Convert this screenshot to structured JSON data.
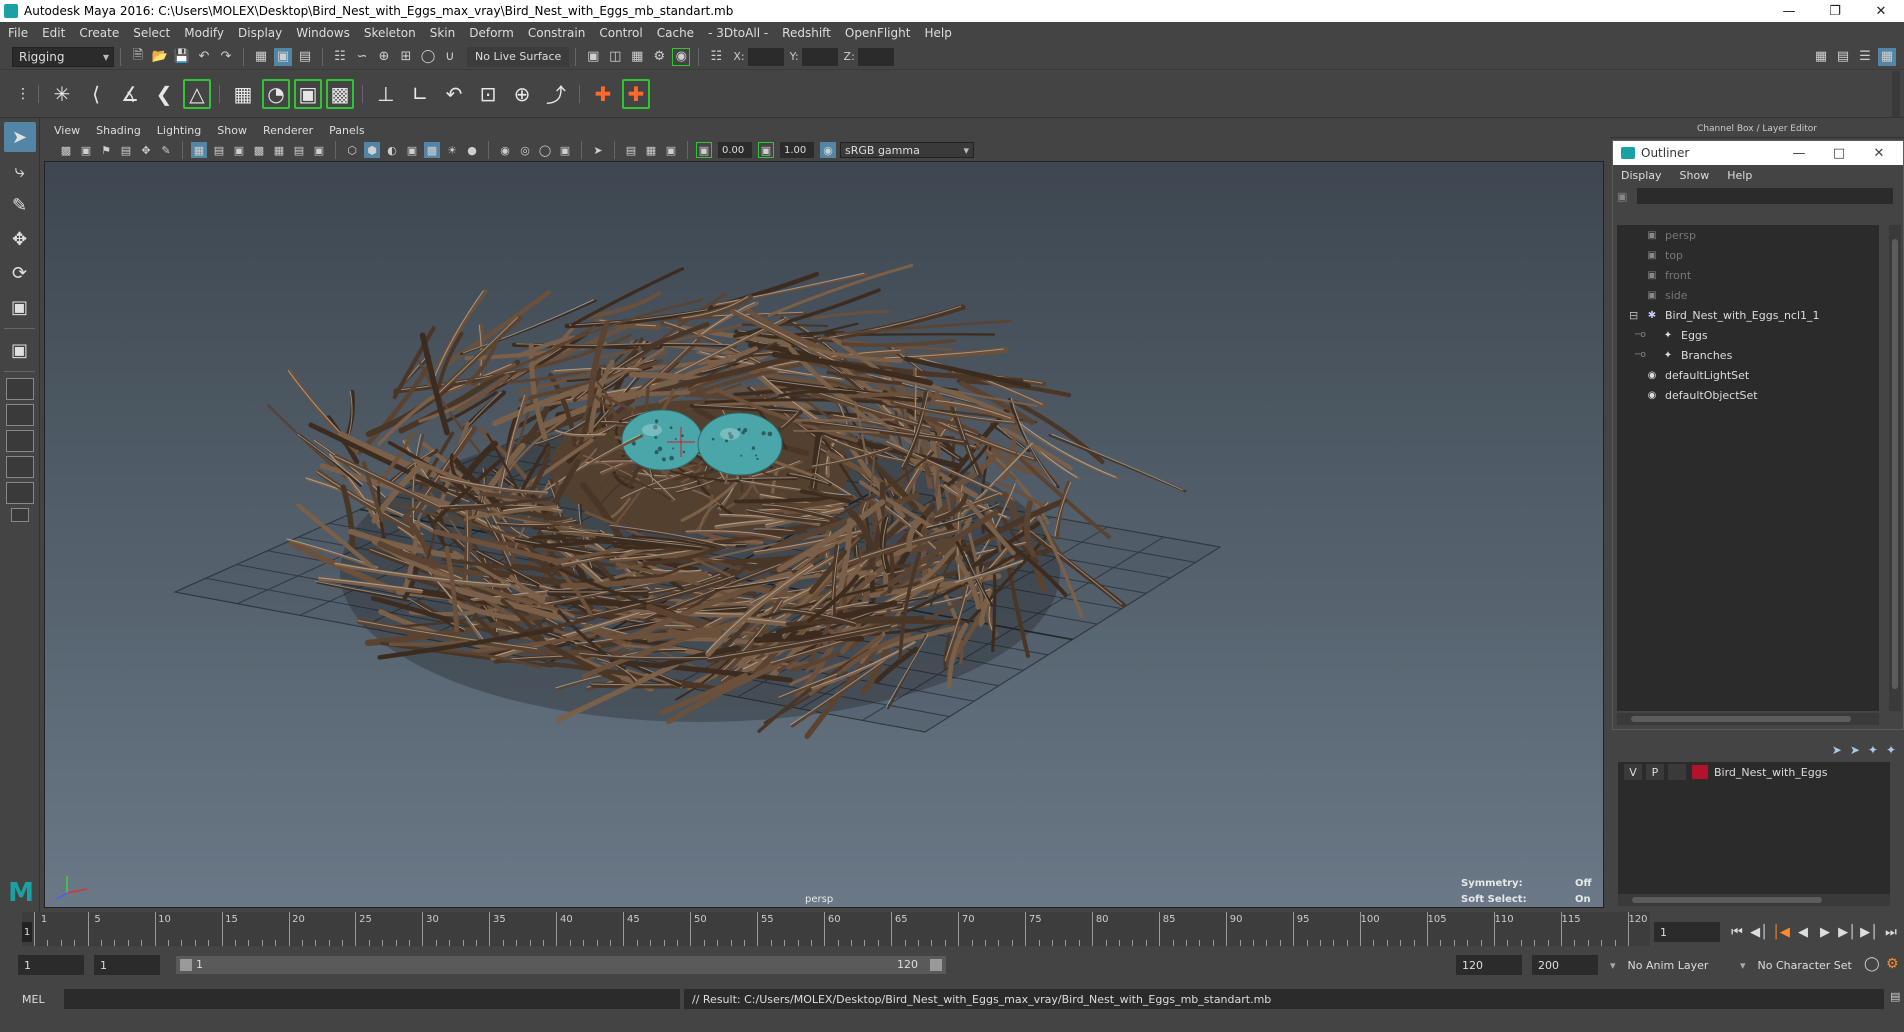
{
  "window": {
    "title": "Autodesk Maya 2016: C:\\Users\\MOLEX\\Desktop\\Bird_Nest_with_Eggs_max_vray\\Bird_Nest_with_Eggs_mb_standart.mb",
    "minimize": "—",
    "restore": "❐",
    "close": "✕"
  },
  "menubar": {
    "items": [
      "File",
      "Edit",
      "Create",
      "Select",
      "Modify",
      "Display",
      "Windows",
      "Skeleton",
      "Skin",
      "Deform",
      "Constrain",
      "Control",
      "Cache",
      "- 3DtoAll -",
      "Redshift",
      "OpenFlight",
      "Help"
    ]
  },
  "statusline": {
    "mode": "Rigging",
    "live_surface": "No Live Surface",
    "x_label": "X:",
    "y_label": "Y:",
    "z_label": "Z:"
  },
  "viewport": {
    "menu": [
      "View",
      "Shading",
      "Lighting",
      "Show",
      "Renderer",
      "Panels"
    ],
    "exposure": "0.00",
    "gamma": "1.00",
    "color_space": "sRGB gamma",
    "camera_label": "persp",
    "symmetry_label": "Symmetry:",
    "symmetry_value": "Off",
    "soft_select_label": "Soft Select:",
    "soft_select_value": "On"
  },
  "channel_box": {
    "title": "Channel Box / Layer Editor"
  },
  "outliner": {
    "title": "Outliner",
    "menu": [
      "Display",
      "Show",
      "Help"
    ],
    "items": [
      {
        "label": "persp",
        "icon": "camera-icon",
        "dim": true,
        "indent": 0
      },
      {
        "label": "top",
        "icon": "camera-icon",
        "dim": true,
        "indent": 0
      },
      {
        "label": "front",
        "icon": "camera-icon",
        "dim": true,
        "indent": 0
      },
      {
        "label": "side",
        "icon": "camera-icon",
        "dim": true,
        "indent": 0
      },
      {
        "label": "Bird_Nest_with_Eggs_ncl1_1",
        "icon": "group-icon",
        "dim": false,
        "indent": 0
      },
      {
        "label": "Eggs",
        "icon": "mesh-icon",
        "dim": false,
        "indent": 1
      },
      {
        "label": "Branches",
        "icon": "mesh-icon",
        "dim": false,
        "indent": 1
      },
      {
        "label": "defaultLightSet",
        "icon": "set-icon",
        "dim": false,
        "indent": 0
      },
      {
        "label": "defaultObjectSet",
        "icon": "set-icon",
        "dim": false,
        "indent": 0
      }
    ]
  },
  "layer_editor": {
    "layers": [
      {
        "visible": "V",
        "playback": "P",
        "color": "#b3122b",
        "name": "Bird_Nest_with_Eggs"
      }
    ]
  },
  "timeline": {
    "ticks": [
      "1",
      "5",
      "10",
      "15",
      "20",
      "25",
      "30",
      "35",
      "40",
      "45",
      "50",
      "55",
      "60",
      "65",
      "70",
      "75",
      "80",
      "85",
      "90",
      "95",
      "100",
      "105",
      "110",
      "115",
      "120"
    ],
    "current_frame": "1",
    "current_frame_marker": "1"
  },
  "range": {
    "start": "1",
    "playback_start": "1",
    "slider_start": "1",
    "slider_end": "120",
    "playback_end": "120",
    "end": "200",
    "anim_layer": "No Anim Layer",
    "character_set": "No Character Set"
  },
  "command_line": {
    "language": "MEL",
    "result": "// Result: C:/Users/MOLEX/Desktop/Bird_Nest_with_Eggs_max_vray/Bird_Nest_with_Eggs_mb_standart.mb"
  },
  "colors": {
    "accent": "#5285a6",
    "maya_teal": "#1aa1a6",
    "layer_red": "#b3122b",
    "egg": "#4aa6a8",
    "twig": "#5a4330"
  }
}
